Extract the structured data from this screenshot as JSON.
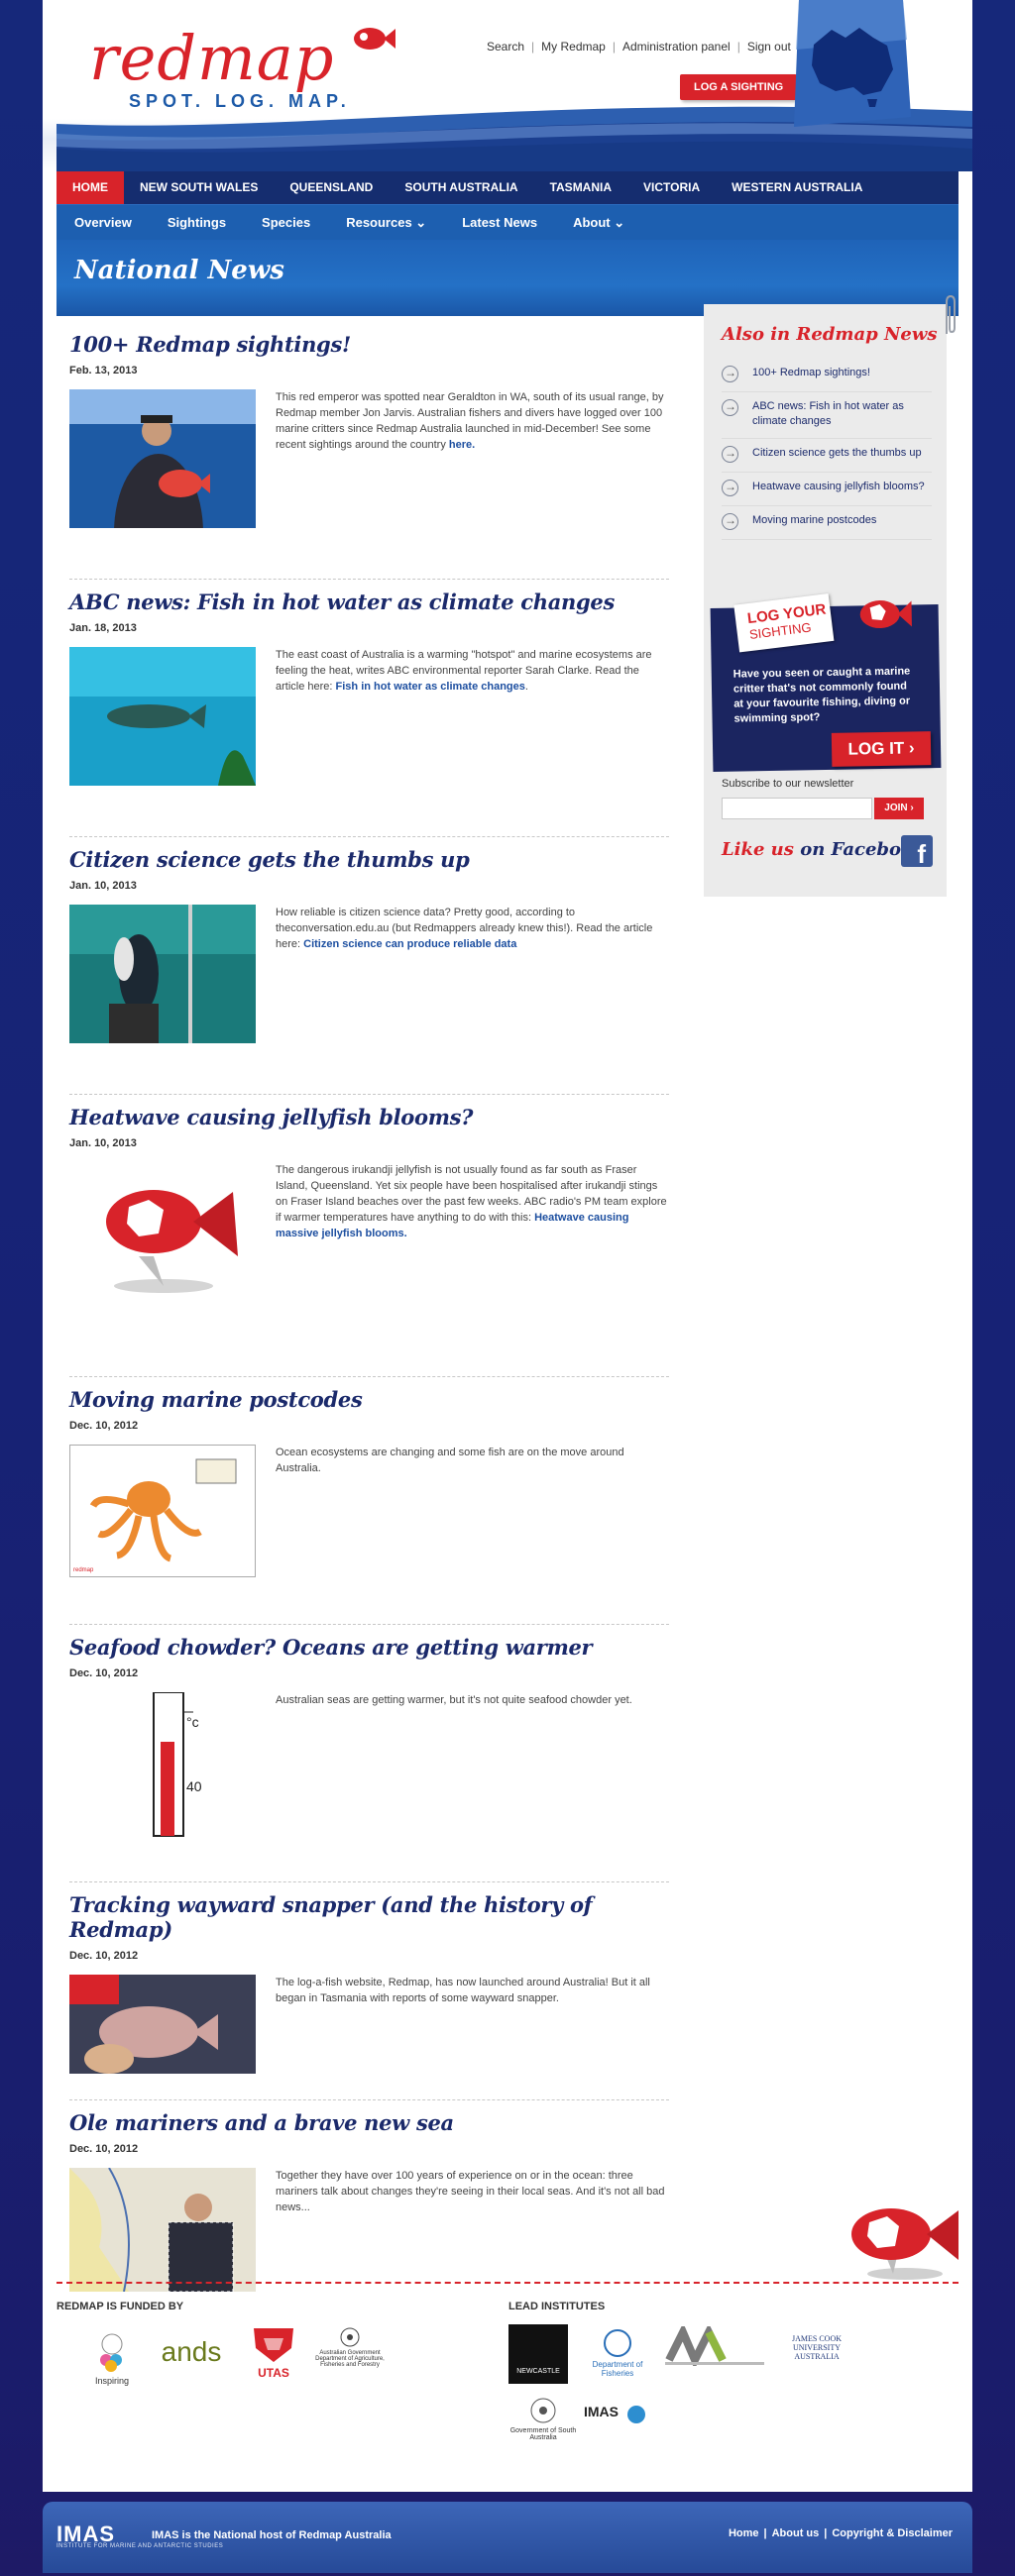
{
  "header": {
    "logo_word": "redmap",
    "logo_tagline": "SPOT. LOG. MAP.",
    "util_nav": [
      "Search",
      "My Redmap",
      "Administration panel",
      "Sign out"
    ],
    "log_sighting_button": "LOG A SIGHTING"
  },
  "main_nav": [
    "HOME",
    "NEW SOUTH WALES",
    "QUEENSLAND",
    "SOUTH AUSTRALIA",
    "TASMANIA",
    "VICTORIA",
    "WESTERN AUSTRALIA"
  ],
  "sub_nav": [
    "Overview",
    "Sightings",
    "Species",
    "Resources ⌄",
    "Latest News",
    "About ⌄"
  ],
  "page_title": "National News",
  "articles": [
    {
      "title": "100+ Redmap sightings!",
      "date": "Feb. 13, 2013",
      "text": "This red emperor was spotted near Geraldton in WA, south of its usual range, by Redmap member Jon Jarvis. Australian fishers and divers have logged over 100 marine critters since Redmap Australia launched in mid-December!  See some recent sightings around the country ",
      "link": "here."
    },
    {
      "title": "ABC news: Fish in hot water as climate changes",
      "date": "Jan. 18, 2013",
      "text": "The east coast of Australia is a warming \"hotspot\" and marine ecosystems are feeling the heat, writes ABC environmental reporter Sarah Clarke. Read the article here: ",
      "link": "Fish in hot water as climate changes",
      "after": "."
    },
    {
      "title": "Citizen science gets the thumbs up",
      "date": "Jan. 10, 2013",
      "text": "How reliable is citizen science data? Pretty good, according to theconversation.edu.au (but Redmappers already knew this!). Read the article here: ",
      "link": "Citizen science can produce reliable data"
    },
    {
      "title": "Heatwave causing jellyfish blooms?",
      "date": "Jan. 10, 2013",
      "text": "The dangerous irukandji jellyfish is not usually found as far south as Fraser Island, Queensland. Yet six people have been hospitalised after irukandji stings on Fraser Island beaches over the past few weeks. ABC radio's PM team explore if warmer temperatures have anything to do with this: ",
      "link": "Heatwave causing massive jellyfish blooms."
    },
    {
      "title": "Moving marine postcodes",
      "date": "Dec. 10, 2012",
      "text": "Ocean ecosystems are changing and some fish are on the move around Australia."
    },
    {
      "title": "Seafood chowder? Oceans are getting warmer",
      "date": "Dec. 10, 2012",
      "text": "Australian seas are getting warmer, but it's not quite seafood chowder yet."
    },
    {
      "title": "Tracking wayward snapper (and the history of Redmap)",
      "date": "Dec. 10, 2012",
      "text": "The log-a-fish website, Redmap, has now launched around Australia! But it all began in Tasmania with reports of some wayward snapper."
    },
    {
      "title": "Ole mariners and a brave new sea",
      "date": "Dec. 10, 2012",
      "text": "Together they have over 100 years of experience on or in the ocean: three mariners talk about changes they're seeing in their local seas. And it's not all bad news..."
    }
  ],
  "sidebar": {
    "title": "Also in Redmap News",
    "items": [
      "100+ Redmap sightings!",
      "ABC news: Fish in hot water as climate changes",
      "Citizen science gets the thumbs up",
      "Heatwave causing jellyfish blooms?",
      "Moving marine postcodes"
    ],
    "log_card_line1": "LOG YOUR",
    "log_card_line2": "SIGHTING",
    "log_text": "Have you seen or caught a marine critter that's not commonly found at your favourite fishing, diving or swimming spot?",
    "log_it": "LOG IT ›",
    "newsletter_label": "Subscribe to our newsletter",
    "join_button": "JOIN ›",
    "facebook_prefix": "Like us",
    "facebook_suffix": "on Facebook"
  },
  "footer": {
    "funded_by": "REDMAP IS FUNDED BY",
    "lead_institutes": "LEAD INSTITUTES",
    "funders": [
      "Inspiring",
      "ands",
      "UTAS",
      "Australian Government Department of Agriculture, Fisheries and Forestry"
    ],
    "institutes": [
      "NEWCASTLE",
      "Department of Fisheries",
      "JAMES COOK UNIVERSITY AUSTRALIA",
      "Government of South Australia",
      "IMAS"
    ],
    "imas_logo": "IMAS",
    "imas_sub": "INSTITUTE FOR MARINE AND ANTARCTIC STUDIES",
    "host_text": "IMAS is the National host of Redmap Australia",
    "links": [
      "Home",
      "About us",
      "Copyright & Disclaimer"
    ]
  },
  "colors": {
    "brand_red": "#d8232a",
    "navy": "#152d6f",
    "blue": "#1d5fb0"
  }
}
